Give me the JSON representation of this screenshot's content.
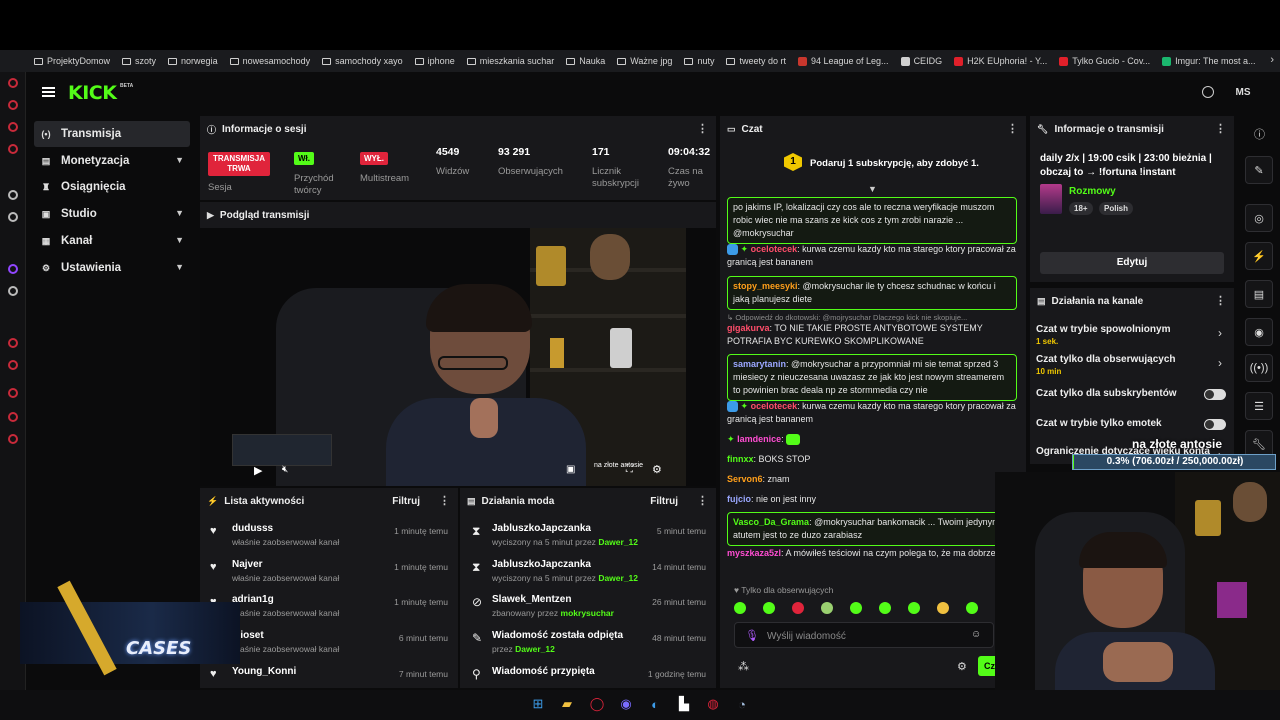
{
  "bookmarks": [
    {
      "label": "ProjektyDomow",
      "kind": "folder"
    },
    {
      "label": "szoty",
      "kind": "folder"
    },
    {
      "label": "norwegia",
      "kind": "folder"
    },
    {
      "label": "nowesamochody",
      "kind": "folder"
    },
    {
      "label": "samochody xayo",
      "kind": "folder"
    },
    {
      "label": "iphone",
      "kind": "folder"
    },
    {
      "label": "mieszkania suchar",
      "kind": "folder"
    },
    {
      "label": "Nauka",
      "kind": "folder"
    },
    {
      "label": "Ważne jpg",
      "kind": "folder"
    },
    {
      "label": "nuty",
      "kind": "folder"
    },
    {
      "label": "tweety do rt",
      "kind": "folder"
    },
    {
      "label": "94 League of Leg...",
      "kind": "site",
      "color": "#c8372d"
    },
    {
      "label": "CEIDG",
      "kind": "site",
      "color": "#d0d0d0"
    },
    {
      "label": "H2K EUphoria! - Y...",
      "kind": "site",
      "color": "#e0202a"
    },
    {
      "label": "Tylko Gucio - Cov...",
      "kind": "site",
      "color": "#e0202a"
    },
    {
      "label": "Imgur: The most a...",
      "kind": "site",
      "color": "#1bb76e"
    }
  ],
  "header": {
    "logo": "KICK",
    "beta": "BETA",
    "user_initials": "MS"
  },
  "nav": [
    {
      "label": "Transmisja",
      "icon": "broadcast-icon",
      "glyph": "(•)",
      "active": true,
      "expandable": false
    },
    {
      "label": "Monetyzacja",
      "icon": "money-icon",
      "glyph": "▤",
      "active": false,
      "expandable": true
    },
    {
      "label": "Osiągnięcia",
      "icon": "trophy-icon",
      "glyph": "♜",
      "active": false,
      "expandable": false
    },
    {
      "label": "Studio",
      "icon": "studio-icon",
      "glyph": "▣",
      "active": false,
      "expandable": true
    },
    {
      "label": "Kanał",
      "icon": "channel-icon",
      "glyph": "▦",
      "active": false,
      "expandable": true
    },
    {
      "label": "Ustawienia",
      "icon": "gear-icon",
      "glyph": "⚙",
      "active": false,
      "expandable": true
    }
  ],
  "session": {
    "title": "Informacje o sesji",
    "status_badge": "TRANSMISJA TRWA",
    "status_label": "Sesja",
    "creator_badge": "Wł.",
    "creator_label": "Przychód twórcy",
    "multistream_badge": "WYŁ.",
    "multistream_label": "Multistream",
    "viewers": "4549",
    "viewers_label": "Widzów",
    "followers": "93 291",
    "followers_label": "Obserwujących",
    "subs": "171",
    "subs_label": "Licznik subskrypcji",
    "time": "09:04:32",
    "time_label": "Czas na żywo"
  },
  "preview": {
    "title": "Podgląd transmisji",
    "overlay_text": "na złote antosie"
  },
  "activity": {
    "title": "Lista aktywności",
    "filter": "Filtruj",
    "rows": [
      {
        "name": "dudusss",
        "desc": "właśnie zaobserwował kanał",
        "time": "1 minutę temu"
      },
      {
        "name": "Najver",
        "desc": "właśnie zaobserwował kanał",
        "time": "1 minutę temu"
      },
      {
        "name": "adrian1g",
        "desc": "właśnie zaobserwował kanał",
        "time": "1 minutę temu"
      },
      {
        "name": "elioset",
        "desc": "właśnie zaobserwował kanał",
        "time": "6 minut temu"
      },
      {
        "name": "Young_Konni",
        "desc": "",
        "time": "7 minut temu"
      }
    ]
  },
  "mod": {
    "title": "Działania moda",
    "filter": "Filtruj",
    "rows": [
      {
        "icon": "hourglass-icon",
        "glyph": "⧗",
        "name": "JabluszkoJapczanka",
        "pre": "wyciszony na 5 minut przez",
        "by": "Dawer_12",
        "time": "5 minut temu"
      },
      {
        "icon": "hourglass-icon",
        "glyph": "⧗",
        "name": "JabluszkoJapczanka",
        "pre": "wyciszony na 5 minut przez",
        "by": "Dawer_12",
        "time": "14 minut temu"
      },
      {
        "icon": "ban-icon",
        "glyph": "⊘",
        "name": "Slawek_Mentzen",
        "pre": "zbanowany przez",
        "by": "mokrysuchar",
        "time": "26 minut temu"
      },
      {
        "icon": "unpin-icon",
        "glyph": "✎",
        "name": "Wiadomość została odpięta",
        "pre": "przez",
        "by": "Dawer_12",
        "time": "48 minut temu"
      },
      {
        "icon": "pin-icon",
        "glyph": "⚲",
        "name": "Wiadomość przypięta",
        "pre": "",
        "by": "",
        "time": "1 godzinę temu"
      }
    ]
  },
  "chat": {
    "title": "Czat",
    "goal_number": "1",
    "goal": "Podaruj 1 subskrypcję, aby zdobyć 1.",
    "messages": [
      {
        "user": "",
        "color": "#ffffff",
        "text": "po jakims IP, lokalizacji czy cos ale to reczna weryfikacje muszom robic wiec nie ma szans ze kick cos z tym zrobi narazie ... @mokrysuchar",
        "highlight": true
      },
      {
        "user": "ocelotecek",
        "color": "#ff4d6a",
        "text": ": kurwa czemu kazdy kto ma starego ktory pracował za granicą jest bananem",
        "highlight": false
      },
      {
        "user": "stopy_meesyki",
        "color": "#ff9f1a",
        "text": ": @mokrysuchar ile ty chcesz schudnac w końcu i jaką planujesz diete",
        "highlight": true
      },
      {
        "user": "",
        "color": "#8a8a8a",
        "text": "↳ Odpowiedź do dkotowski: @mojrysuchar Dlaczego kick nie skopiuje...",
        "highlight": false
      },
      {
        "user": "gigakurva",
        "color": "#ff4d6a",
        "text": ": TO NIE TAKIE PROSTE ANTYBOTOWE SYSTEMY POTRAFIA BYC KUREWKO SKOMPLIKOWANE",
        "highlight": false
      },
      {
        "user": "samarytanin",
        "color": "#9aa7ff",
        "text": ": @mokrysuchar a przypomniał mi sie temat sprzed 3 miesiecy z nieuczesana uwazasz ze jak kto jest nowym streamerem to powinien brac deala np ze stormmedia czy nie",
        "highlight": true
      },
      {
        "user": "ocelotecek",
        "color": "#ff4d6a",
        "text": ": kurwa czemu kazdy kto ma starego ktory pracował za granicą jest bananem",
        "highlight": false
      },
      {
        "user": "lamdenice",
        "color": "#ff4dd2",
        "text": ":",
        "highlight": false
      },
      {
        "user": "finnxx",
        "color": "#53fc18",
        "text": ": BOKS STOP",
        "highlight": false
      },
      {
        "user": "Servon6",
        "color": "#ff9f1a",
        "text": ": znam",
        "highlight": false
      },
      {
        "user": "fujcio",
        "color": "#9aa7ff",
        "text": ": nie on jest inny",
        "highlight": false
      },
      {
        "user": "Vasco_Da_Grama",
        "color": "#53fc18",
        "text": ": @mokrysuchar bankomacik ... Twoim jedynym atutem jest to ze duzo zarabiasz",
        "highlight": true
      },
      {
        "user": "myszkaza5zl",
        "color": "#ff4dd2",
        "text": ": A mówiłeś teściowi na czym polega to, że ma dobrze?",
        "highlight": false
      }
    ],
    "followers_only": "Tylko dla obserwujących",
    "input_placeholder": "Wyślij wiadomość",
    "send": "Czat"
  },
  "stream_info": {
    "title": "Informacje o transmisji",
    "stream_title": "daily 2/x | 19:00 csik | 23:00 bieżnia | obczaj to → !fortuna !instant :csgoskin...",
    "category": "Rozmowy",
    "tags": [
      "18+",
      "Polish"
    ],
    "edit": "Edytuj"
  },
  "channel_actions": {
    "title": "Działania na kanale",
    "items": [
      {
        "label": "Czat w trybie spowolnionym",
        "sub": "1 sek.",
        "control": "chevron"
      },
      {
        "label": "Czat tylko dla obserwujących",
        "sub": "10 min",
        "control": "chevron"
      },
      {
        "label": "Czat tylko dla subskrybentów",
        "sub": "",
        "control": "toggle"
      },
      {
        "label": "Czat w trybie tylko emotek",
        "sub": "",
        "control": "toggle"
      },
      {
        "label": "Ograniczenie dotyczące wieku konta",
        "sub": "",
        "control": "chevron"
      }
    ]
  },
  "overlay": {
    "goal_title": "na złote antosie",
    "goal_progress": "0.3% (706.00zł / 250,000.00zł)",
    "goal_fraction": 0.003,
    "cases_text": "CASES"
  }
}
